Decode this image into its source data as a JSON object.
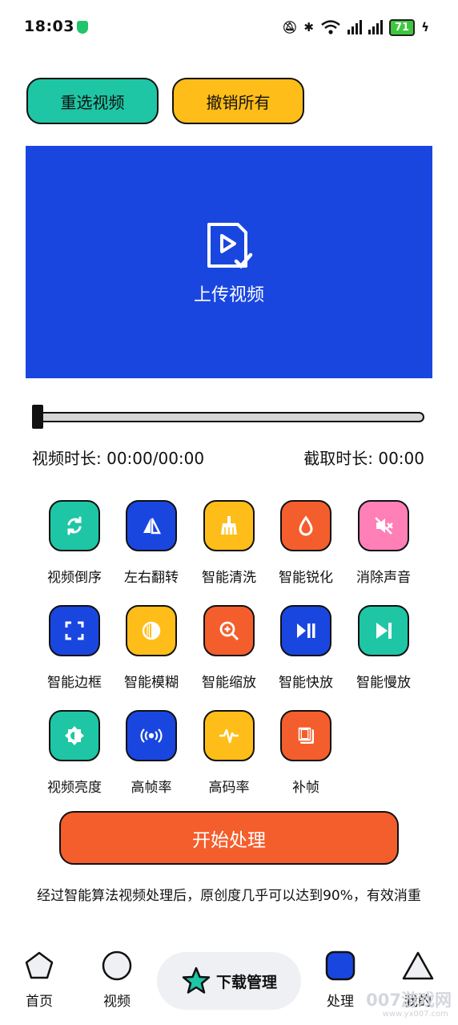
{
  "status_bar": {
    "time": "18:03",
    "battery": "71"
  },
  "actions": {
    "reselect_label": "重选视频",
    "undo_all_label": "撤销所有"
  },
  "colors": {
    "teal": "#1ec6a5",
    "yellow": "#ffbd19",
    "orange": "#f45e2c",
    "blue": "#1a46e0",
    "pink": "#ff7fb7"
  },
  "upload": {
    "label": "上传视频"
  },
  "slider": {
    "progress": 0
  },
  "durations": {
    "video": "视频时长: 00:00/00:00",
    "clip": "截取时长: 00:00"
  },
  "tools": [
    {
      "label": "视频倒序",
      "icon": "refresh-icon",
      "color": "teal"
    },
    {
      "label": "左右翻转",
      "icon": "flip-horizontal-icon",
      "color": "blue"
    },
    {
      "label": "智能清洗",
      "icon": "broom-icon",
      "color": "yellow"
    },
    {
      "label": "智能锐化",
      "icon": "droplet-icon",
      "color": "orange"
    },
    {
      "label": "消除声音",
      "icon": "mute-icon",
      "color": "pink"
    },
    {
      "label": "智能边框",
      "icon": "frame-icon",
      "color": "blue"
    },
    {
      "label": "智能模糊",
      "icon": "blur-icon",
      "color": "yellow"
    },
    {
      "label": "智能缩放",
      "icon": "zoom-in-icon",
      "color": "orange"
    },
    {
      "label": "智能快放",
      "icon": "play-pause-icon",
      "color": "blue"
    },
    {
      "label": "智能慢放",
      "icon": "skip-next-icon",
      "color": "teal"
    },
    {
      "label": "视频亮度",
      "icon": "brightness-icon",
      "color": "teal"
    },
    {
      "label": "高帧率",
      "icon": "broadcast-icon",
      "color": "blue"
    },
    {
      "label": "高码率",
      "icon": "waveform-icon",
      "color": "yellow"
    },
    {
      "label": "补帧",
      "icon": "film-icon",
      "color": "orange"
    }
  ],
  "start_button": {
    "label": "开始处理"
  },
  "note": "经过智能算法视频处理后，原创度几乎可以达到90%，有效消重",
  "nav": {
    "home": "首页",
    "video": "视频",
    "download": "下载管理",
    "process": "处理",
    "mine": "我的"
  },
  "watermark": {
    "text": "007游戏网",
    "url": "www.yx007.com"
  }
}
